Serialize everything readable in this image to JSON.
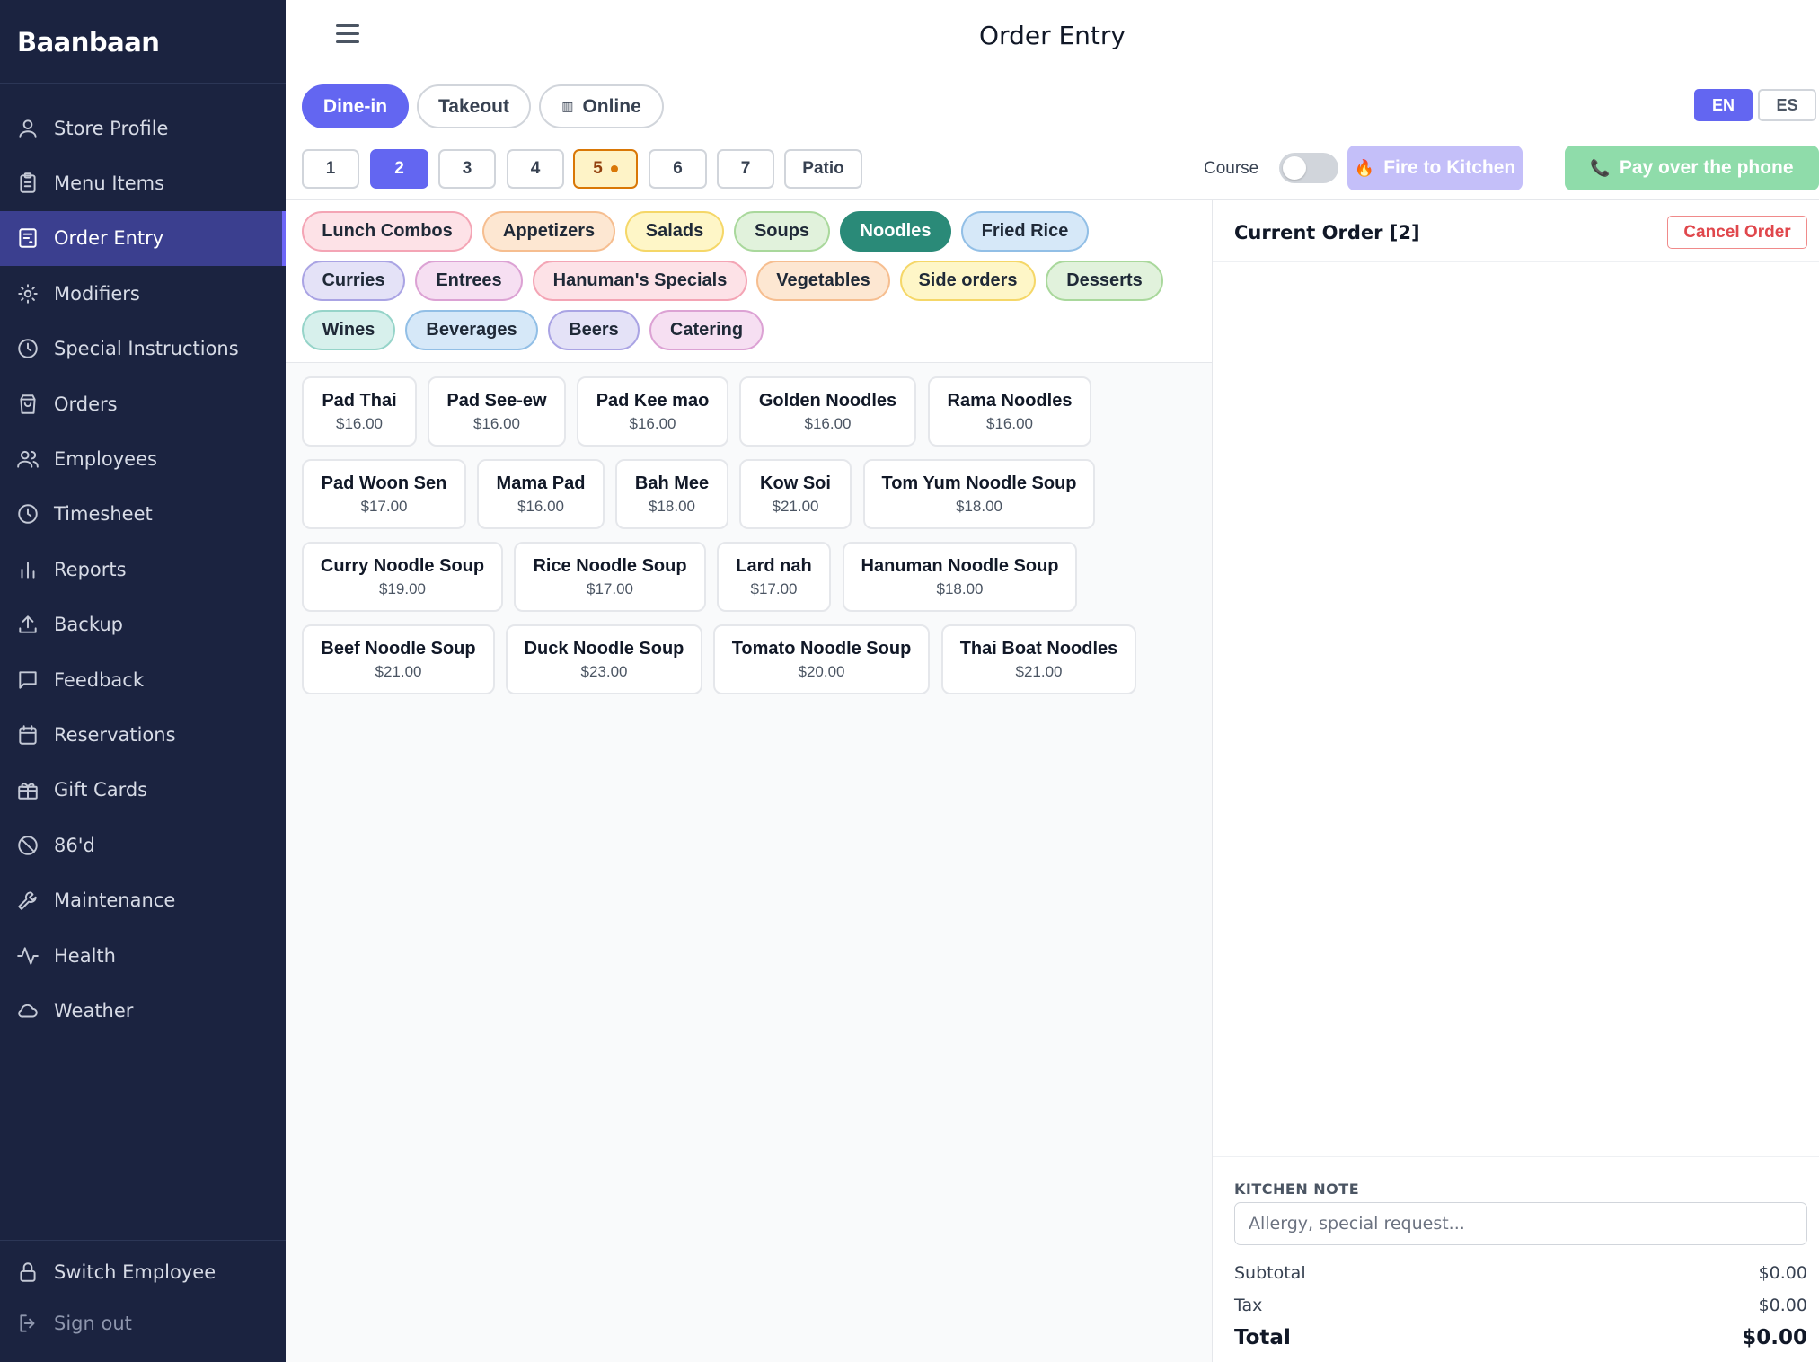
{
  "app": {
    "brand": "Baanbaan"
  },
  "sidebar": {
    "items": [
      {
        "label": "Store Profile",
        "icon": "user-icon"
      },
      {
        "label": "Menu Items",
        "icon": "clipboard-icon"
      },
      {
        "label": "Order Entry",
        "icon": "receipt-icon",
        "active": true
      },
      {
        "label": "Modifiers",
        "icon": "sun-icon"
      },
      {
        "label": "Special Instructions",
        "icon": "clock-icon"
      },
      {
        "label": "Orders",
        "icon": "bag-icon"
      },
      {
        "label": "Employees",
        "icon": "users-icon"
      },
      {
        "label": "Timesheet",
        "icon": "clock-icon"
      },
      {
        "label": "Reports",
        "icon": "bar-chart-icon"
      },
      {
        "label": "Backup",
        "icon": "upload-icon"
      },
      {
        "label": "Feedback",
        "icon": "message-icon"
      },
      {
        "label": "Reservations",
        "icon": "calendar-icon"
      },
      {
        "label": "Gift Cards",
        "icon": "gift-icon"
      },
      {
        "label": "86'd",
        "icon": "ban-icon"
      },
      {
        "label": "Maintenance",
        "icon": "wrench-icon"
      },
      {
        "label": "Health",
        "icon": "activity-icon"
      },
      {
        "label": "Weather",
        "icon": "cloud-icon"
      }
    ],
    "bottom": [
      {
        "label": "Switch Employee",
        "icon": "lock-icon"
      },
      {
        "label": "Sign out",
        "icon": "sign-out-icon"
      }
    ]
  },
  "header": {
    "title": "Order Entry"
  },
  "order_types": [
    {
      "label": "Dine-in",
      "active": true
    },
    {
      "label": "Takeout"
    },
    {
      "label": "Online",
      "icon": "barcode-icon"
    }
  ],
  "languages": [
    {
      "label": "EN",
      "active": true
    },
    {
      "label": "ES"
    }
  ],
  "tables": [
    {
      "label": "1"
    },
    {
      "label": "2",
      "active": true
    },
    {
      "label": "3"
    },
    {
      "label": "4"
    },
    {
      "label": "5",
      "occupied": true
    },
    {
      "label": "6"
    },
    {
      "label": "7"
    },
    {
      "label": "Patio"
    }
  ],
  "controls": {
    "course_label": "Course",
    "course_enabled": false,
    "fire_label": "Fire to Kitchen",
    "pay_label": "Pay over the phone"
  },
  "categories": [
    {
      "label": "Lunch Combos",
      "color": "#fde2e7"
    },
    {
      "label": "Appetizers",
      "color": "#fde7d2"
    },
    {
      "label": "Salads",
      "color": "#fef6c7"
    },
    {
      "label": "Soups",
      "color": "#e1f2dc"
    },
    {
      "label": "Noodles",
      "color": "#2a8a78",
      "active": true
    },
    {
      "label": "Fried Rice",
      "color": "#d6e8f8"
    },
    {
      "label": "Curries",
      "color": "#e4e2f7"
    },
    {
      "label": "Entrees",
      "color": "#f6dff2"
    },
    {
      "label": "Hanuman's Specials",
      "color": "#fde2e7"
    },
    {
      "label": "Vegetables",
      "color": "#fde7d2"
    },
    {
      "label": "Side orders",
      "color": "#fef6c7"
    },
    {
      "label": "Desserts",
      "color": "#e1f2dc"
    },
    {
      "label": "Wines",
      "color": "#d7f0ec"
    },
    {
      "label": "Beverages",
      "color": "#d6e8f8"
    },
    {
      "label": "Beers",
      "color": "#e4e2f7"
    },
    {
      "label": "Catering",
      "color": "#f6dff2"
    }
  ],
  "menu_items": [
    {
      "name": "Pad Thai",
      "price": "$16.00"
    },
    {
      "name": "Pad See-ew",
      "price": "$16.00"
    },
    {
      "name": "Pad Kee mao",
      "price": "$16.00"
    },
    {
      "name": "Golden Noodles",
      "price": "$16.00"
    },
    {
      "name": "Rama Noodles",
      "price": "$16.00"
    },
    {
      "name": "Pad Woon Sen",
      "price": "$17.00"
    },
    {
      "name": "Mama Pad",
      "price": "$16.00"
    },
    {
      "name": "Bah Mee",
      "price": "$18.00"
    },
    {
      "name": "Kow Soi",
      "price": "$21.00"
    },
    {
      "name": "Tom Yum Noodle Soup",
      "price": "$18.00"
    },
    {
      "name": "Curry Noodle Soup",
      "price": "$19.00"
    },
    {
      "name": "Rice Noodle Soup",
      "price": "$17.00"
    },
    {
      "name": "Lard nah",
      "price": "$17.00"
    },
    {
      "name": "Hanuman Noodle Soup",
      "price": "$18.00"
    },
    {
      "name": "Beef Noodle Soup",
      "price": "$21.00"
    },
    {
      "name": "Duck Noodle Soup",
      "price": "$23.00"
    },
    {
      "name": "Tomato Noodle Soup",
      "price": "$20.00"
    },
    {
      "name": "Thai Boat Noodles",
      "price": "$21.00"
    }
  ],
  "order": {
    "title": "Current Order [2]",
    "cancel_label": "Cancel Order",
    "kitchen_note_label": "KITCHEN NOTE",
    "kitchen_note_placeholder": "Allergy, special request...",
    "kitchen_note_value": "",
    "subtotal_label": "Subtotal",
    "subtotal": "$0.00",
    "tax_label": "Tax",
    "tax": "$0.00",
    "total_label": "Total",
    "total": "$0.00"
  }
}
